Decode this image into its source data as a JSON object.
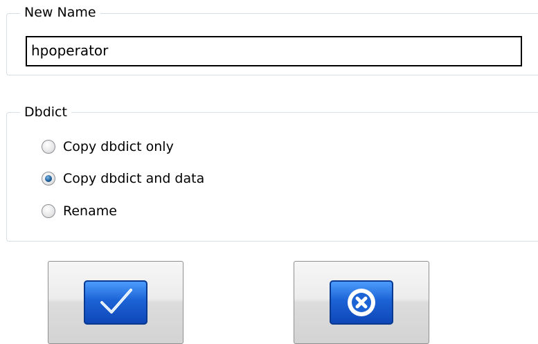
{
  "name_group": {
    "legend": "New Name",
    "value": "hpoperator"
  },
  "dbdict_group": {
    "legend": "Dbdict",
    "options": [
      {
        "label": "Copy dbdict only",
        "checked": false
      },
      {
        "label": "Copy dbdict and data",
        "checked": true
      },
      {
        "label": "Rename",
        "checked": false
      }
    ]
  },
  "buttons": {
    "ok_icon": "checkmark-icon",
    "cancel_icon": "cancel-x-icon"
  },
  "colors": {
    "group_border": "#d5dfe5",
    "icon_blue": "#1c63d6",
    "radio_selected": "#1f5f9a"
  }
}
